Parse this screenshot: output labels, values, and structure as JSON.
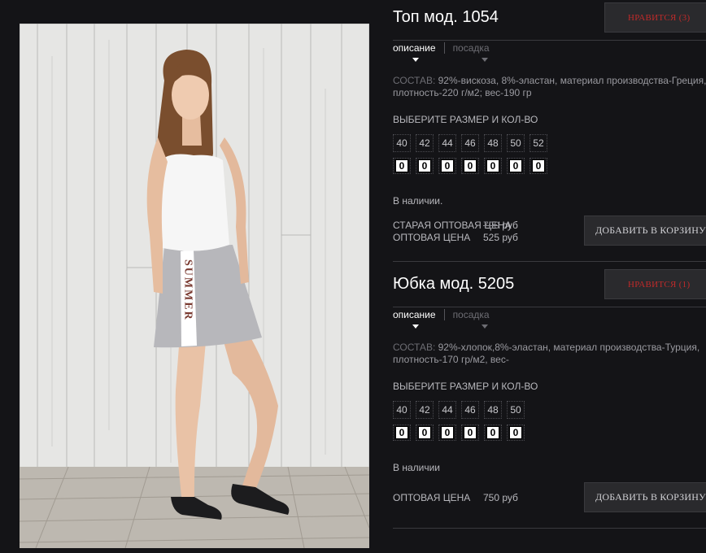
{
  "photo": {
    "print_text": "SUMMER"
  },
  "products": [
    {
      "title": "Топ мод. 1054",
      "like_label": "НРАВИТСЯ (3)",
      "tabs": [
        "описание",
        "посадка"
      ],
      "composition_label": "СОСТАВ:",
      "composition_line1": "92%-вискоза, 8%-эластан, материал производства-Греция,",
      "composition_line2": "плотность-220 г/м2; вес-190 гр",
      "choose_label": "ВЫБЕРИТЕ РАЗМЕР И КОЛ-ВО",
      "sizes": [
        "40",
        "42",
        "44",
        "46",
        "48",
        "50",
        "52"
      ],
      "quantities": [
        "0",
        "0",
        "0",
        "0",
        "0",
        "0",
        "0"
      ],
      "stock": "В наличии.",
      "old_price_label": "СТАРАЯ ОПТОВАЯ ЦЕНА",
      "old_price": "700",
      "old_price_currency": "руб",
      "price_label": "ОПТОВАЯ ЦЕНА",
      "price": "525 руб",
      "cart_label": "ДОБАВИТЬ В КОРЗИНУ"
    },
    {
      "title": "Юбка мод. 5205",
      "like_label": "НРАВИТСЯ (1)",
      "tabs": [
        "описание",
        "посадка"
      ],
      "composition_label": "СОСТАВ:",
      "composition_line1": "92%-хлопок,8%-эластан, материал производства-Турция,",
      "composition_line2": "плотность-170 гр/м2, вес-",
      "choose_label": "ВЫБЕРИТЕ РАЗМЕР И КОЛ-ВО",
      "sizes": [
        "40",
        "42",
        "44",
        "46",
        "48",
        "50"
      ],
      "quantities": [
        "0",
        "0",
        "0",
        "0",
        "0",
        "0"
      ],
      "stock": "В наличии",
      "price_label": "ОПТОВАЯ ЦЕНА",
      "price": "750 руб",
      "cart_label": "ДОБАВИТЬ В КОРЗИНУ"
    }
  ],
  "colors": {
    "background": "#141417",
    "accent_red": "#c02a2a",
    "button_bg": "#2a2a2d"
  }
}
